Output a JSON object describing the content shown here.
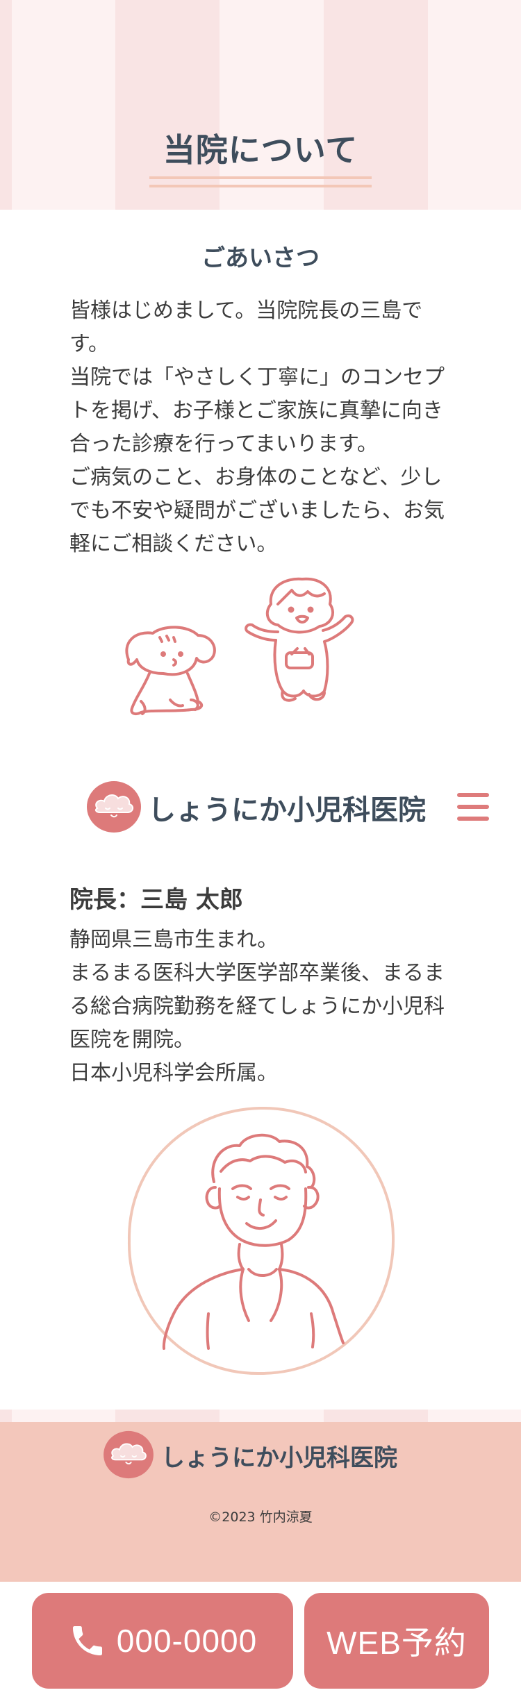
{
  "hero": {
    "title": "当院について"
  },
  "greeting": {
    "heading": "ごあいさつ",
    "body": "皆様はじめまして。当院院長の三島です。\n当院では「やさしく丁寧に」のコンセプトを掲げ、お子様とご家族に真摯に向き合った診療を行ってまいります。\nご病気のこと、お身体のことなど、少しでも不安や疑問がございましたら、お気軽にご相談ください。"
  },
  "header": {
    "brand_name": "しょうにか小児科医院",
    "logo_icon": "cloud-logo-icon",
    "menu_icon": "hamburger-menu-icon"
  },
  "director": {
    "heading": "院長：三島 太郎",
    "bio": "静岡県三島市生まれ。\nまるまる医科大学医学部卒業後、まるまる総合病院勤務を経てしょうにか小児科医院を開院。\n日本小児科学会所属。"
  },
  "footer": {
    "brand_name": "しょうにか小児科医院",
    "copyright": "©2023 竹内涼夏"
  },
  "cta": {
    "phone_label": "000-0000",
    "phone_icon": "phone-icon",
    "web_label": "WEB予約"
  },
  "colors": {
    "accent": "#dd7a7a",
    "heading": "#3e4d5c",
    "footer_bg": "#f3c7bb",
    "stripe_light": "#fdf2f2",
    "stripe_dark": "#f9e4e4"
  }
}
